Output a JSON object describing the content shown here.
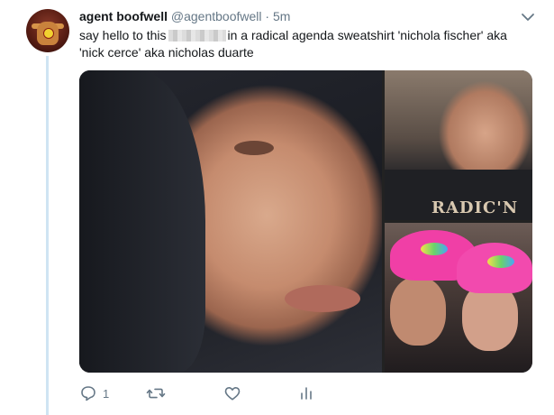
{
  "tweet": {
    "display_name": "agent boofwell",
    "handle": "@agentboofwell",
    "separator": "·",
    "time": "5m",
    "text_part1": "say hello to this",
    "text_part2": "in a radical agenda sweatshirt 'nichola fischer' aka 'nick cerce' aka nicholas duarte",
    "shirt_text": "RADIC'N"
  },
  "actions": {
    "reply_count": "1",
    "retweet_count": "",
    "like_count": ""
  },
  "icons": {
    "caret": "chevron-down-icon",
    "reply": "reply-icon",
    "retweet": "retweet-icon",
    "like": "heart-icon",
    "analytics": "analytics-icon"
  },
  "colors": {
    "thread_line": "#cfe4f3",
    "secondary_text": "#657786",
    "primary_text": "#14171a"
  }
}
